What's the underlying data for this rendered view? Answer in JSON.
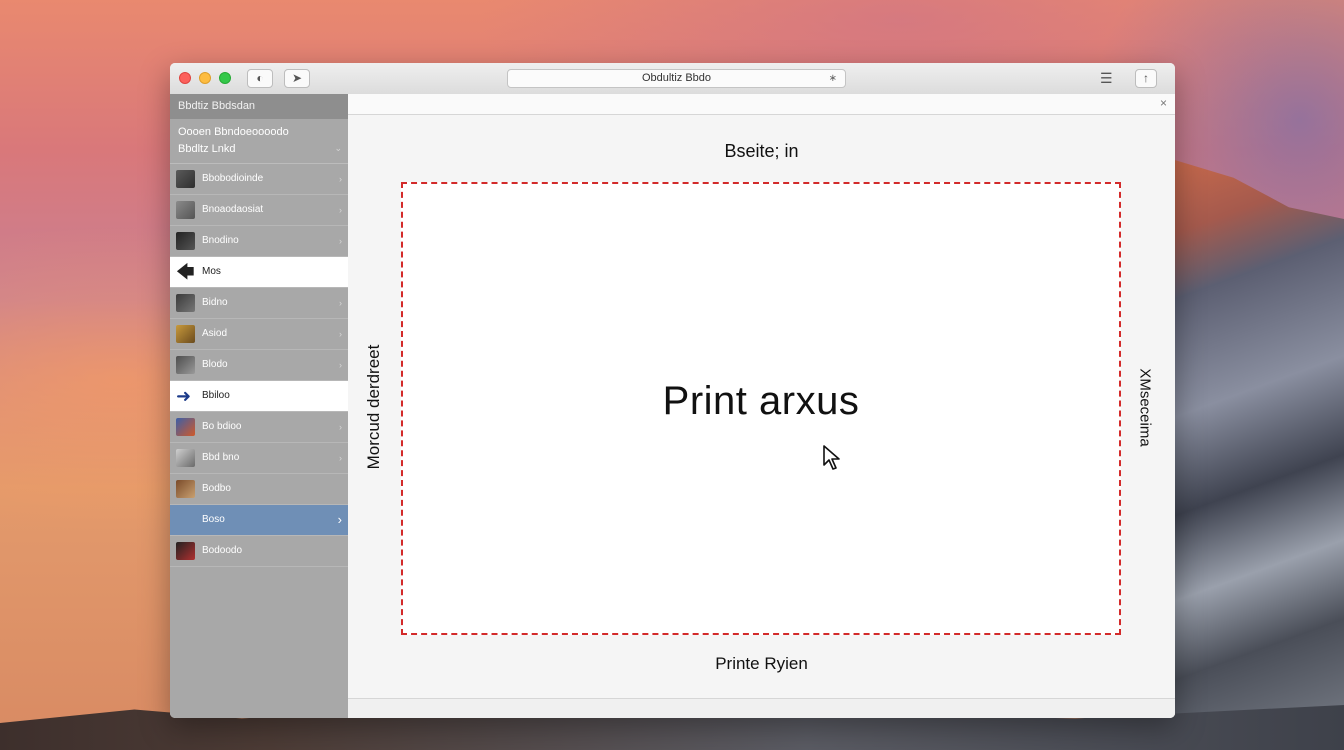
{
  "window": {
    "address": "Obdultiz Bbdo",
    "back_icon": "back-icon",
    "share_icon": "share-icon"
  },
  "sidebar": {
    "header": "Bbdtiz Bbdsdan",
    "sub_line1": "Oooen Bbndoeoooodo",
    "sub_line2": "Bbdltz Lnkd",
    "items": [
      {
        "label": "Bbobodioinde",
        "style": "normal"
      },
      {
        "label": "Bnoaodaosiat",
        "style": "normal"
      },
      {
        "label": "Bnodino",
        "style": "normal"
      },
      {
        "label": "Mos",
        "style": "white"
      },
      {
        "label": "Bidno",
        "style": "normal"
      },
      {
        "label": "Asiod",
        "style": "normal"
      },
      {
        "label": "Blodo",
        "style": "normal"
      },
      {
        "label": "Bbiloo",
        "style": "white"
      },
      {
        "label": "Bo bdioo",
        "style": "normal"
      },
      {
        "label": "Bbd bno",
        "style": "normal"
      },
      {
        "label": "Bodbo",
        "style": "normal"
      },
      {
        "label": "Boso",
        "style": "selected"
      },
      {
        "label": "Bodoodo",
        "style": "normal"
      }
    ]
  },
  "preview": {
    "header": "Bseite; in",
    "center": "Print arxus",
    "left_label": "Morcud derdreet",
    "right_label": "XMseceima",
    "footer": "Printe Ryien"
  }
}
